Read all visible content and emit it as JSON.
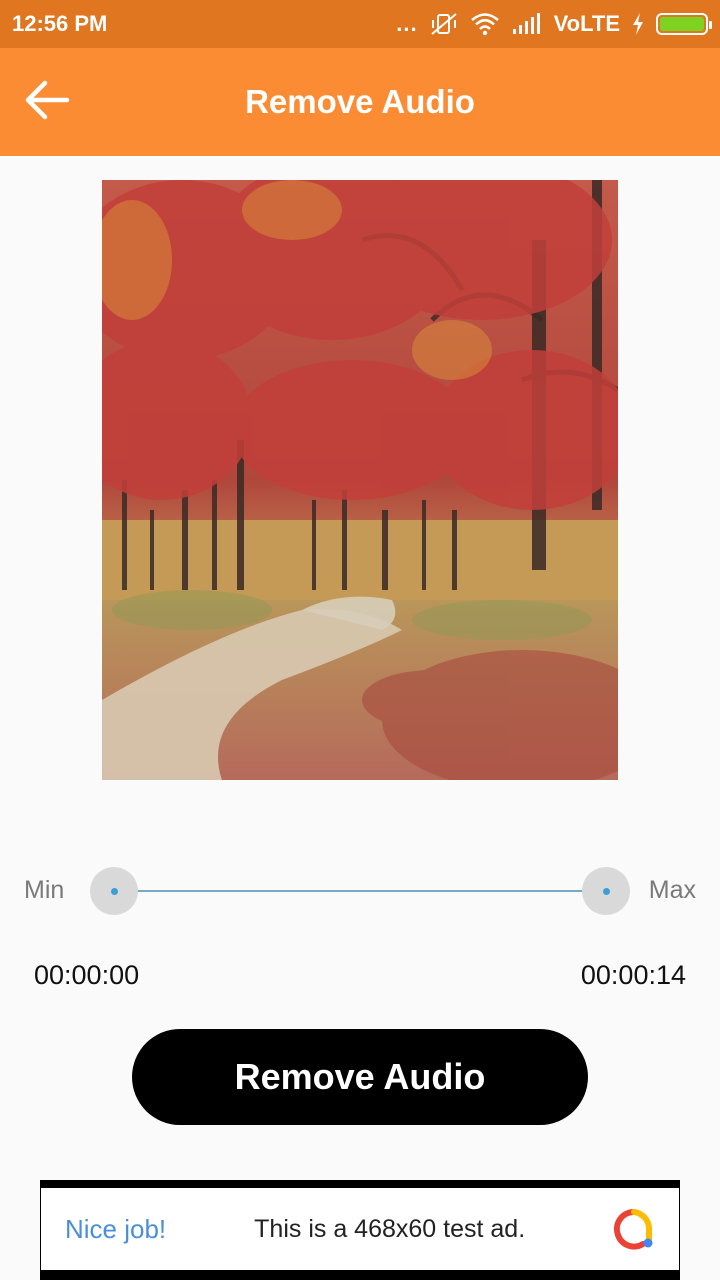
{
  "status_bar": {
    "time": "12:56 PM",
    "dots": "...",
    "network": "VoLTE",
    "icons": [
      "mute-vibrate-icon",
      "wifi-icon",
      "signal-icon",
      "charging-icon",
      "battery-icon"
    ],
    "battery_level": 1.0
  },
  "app_bar": {
    "title": "Remove Audio",
    "back_icon": "arrow-left-icon"
  },
  "video": {
    "description_icon": "autumn-forest-video-frame"
  },
  "range": {
    "min_label": "Min",
    "max_label": "Max",
    "start_time": "00:00:00",
    "end_time": "00:00:14"
  },
  "action": {
    "remove_label": "Remove Audio"
  },
  "ad": {
    "nice_label": "Nice job!",
    "text": "This is a 468x60 test ad."
  },
  "colors": {
    "status_bar": "#e0761f",
    "app_bar": "#fb8c33",
    "button": "#000000",
    "slider_accent": "#3a9ed8",
    "ad_link": "#4a8fd8"
  }
}
